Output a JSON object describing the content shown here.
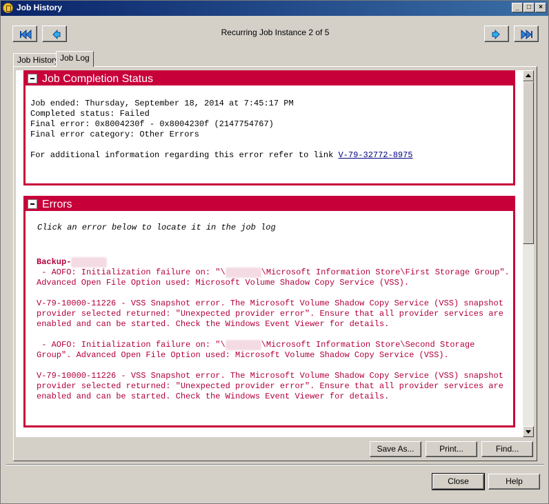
{
  "window": {
    "title": "Job History",
    "controls": {
      "minimize": "_",
      "maximize": "□",
      "close": "×"
    }
  },
  "nav": {
    "instance_label": "Recurring Job Instance 2 of 5",
    "buttons": [
      "first-icon",
      "previous-icon",
      "next-icon",
      "last-icon"
    ]
  },
  "tabs": [
    {
      "label": "Job History",
      "active": false
    },
    {
      "label": "Job Log",
      "active": true
    }
  ],
  "completion": {
    "title": "Job Completion Status",
    "lines": [
      "Job ended: Thursday, September 18, 2014 at 7:45:17 PM",
      "Completed status: Failed",
      "Final error: 0x8004230f - 0x8004230f (2147754767)",
      "Final error category: Other Errors"
    ],
    "link_prefix": "For additional information regarding this error refer to link ",
    "link_text": "V-79-32772-8975"
  },
  "errors": {
    "title": "Errors",
    "instruction": "Click an error below to locate it in the job log",
    "backup_label": "Backup-",
    "items": [
      {
        "line1": " - AOFO: Initialization failure on: \"\\",
        "line1_end": "\\Microsoft Information Store\\First Storage Group\".",
        "line2": "Advanced Open File Option used: Microsoft Volume Shadow Copy Service (VSS).",
        "line3": "",
        "line4": "V-79-10000-11226 - VSS Snapshot error. The Microsoft Volume Shadow Copy Service (VSS) snapshot",
        "line5": "provider selected returned: \"Unexpected provider error\". Ensure that all provider services are",
        "line6": "enabled and can be started. Check the Windows Event Viewer for details."
      },
      {
        "line1": " - AOFO: Initialization failure on: \"\\",
        "line1_end": "\\Microsoft Information Store\\Second Storage",
        "line2": "Group\". Advanced Open File Option used: Microsoft Volume Shadow Copy Service (VSS).",
        "line3": "",
        "line4": "V-79-10000-11226 - VSS Snapshot error. The Microsoft Volume Shadow Copy Service (VSS) snapshot",
        "line5": "provider selected returned: \"Unexpected provider error\". Ensure that all provider services are",
        "line6": "enabled and can be started. Check the Windows Event Viewer for details."
      }
    ]
  },
  "actions": {
    "save_as": "Save As...",
    "print": "Print...",
    "find": "Find..."
  },
  "footer": {
    "close": "Close",
    "help": "Help"
  },
  "colors": {
    "section_accent": "#c8003a",
    "error_text": "#b0003a",
    "titlebar": "#0a246a"
  }
}
